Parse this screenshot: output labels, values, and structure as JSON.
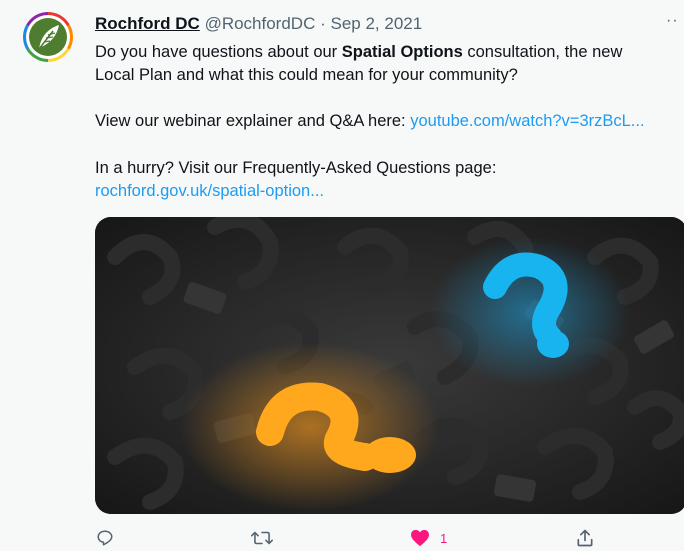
{
  "tweet": {
    "author_name": "Rochford DC",
    "handle": "@RochfordDC",
    "separator": "·",
    "date": "Sep 2, 2021",
    "text_part1": "Do you have questions about our ",
    "text_bold": "Spatial Options",
    "text_part2": " consultation, the new",
    "text_line2": "Local Plan and what this could mean for your community?",
    "webinar_text": "View our webinar explainer and Q&A here: ",
    "webinar_link": "youtube.com/watch?v=3rzBcL...",
    "faq_text": "In a hurry? Visit our Frequently-Asked Questions page:",
    "faq_link": "rochford.gov.uk/spatial-option...",
    "more_label": "··"
  },
  "actions": {
    "reply_icon": "reply-icon",
    "retweet_icon": "retweet-icon",
    "like_icon": "heart-icon",
    "like_count": "1",
    "share_icon": "share-icon"
  },
  "colors": {
    "link": "#1d9bf0",
    "like": "#f91880",
    "avatar_green": "#4e7d2f",
    "orange_mark": "#ffa81e",
    "blue_mark": "#18b4f0"
  }
}
